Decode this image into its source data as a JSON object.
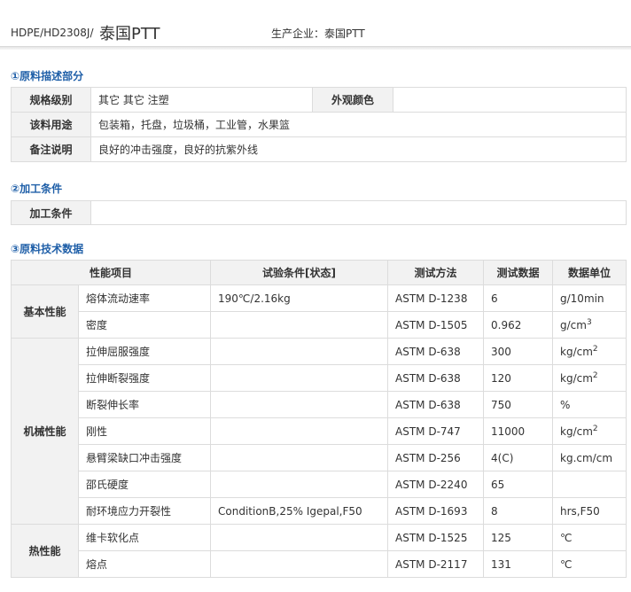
{
  "header": {
    "code": "HDPE/HD2308J/",
    "brand": "泰国PTT",
    "producer": "生产企业：泰国PTT"
  },
  "section1": {
    "title": "①原料描述部分",
    "rows": {
      "grade_label": "规格级别",
      "grade_value": "其它 其它 注塑",
      "appearance_label": "外观颜色",
      "appearance_value": "",
      "usage_label": "该料用途",
      "usage_value": "包装箱，托盘，垃圾桶，工业管，水果篮",
      "notes_label": "备注说明",
      "notes_value": "良好的冲击强度，良好的抗紫外线"
    }
  },
  "section2": {
    "title": "②加工条件",
    "label": "加工条件",
    "value": ""
  },
  "section3": {
    "title": "③原料技术数据",
    "headers": [
      "性能项目",
      "试验条件[状态]",
      "测试方法",
      "测试数据",
      "数据单位"
    ],
    "groups": {
      "basic": "基本性能",
      "mechanical": "机械性能",
      "thermal": "热性能"
    },
    "rows": [
      {
        "item": "熔体流动速率",
        "cond": "190℃/2.16kg",
        "method": "ASTM D-1238",
        "value": "6",
        "unit": "g/10min",
        "sup": ""
      },
      {
        "item": "密度",
        "cond": "",
        "method": "ASTM D-1505",
        "value": "0.962",
        "unit": "g/cm",
        "sup": "3"
      },
      {
        "item": "拉伸屈服强度",
        "cond": "",
        "method": "ASTM D-638",
        "value": "300",
        "unit": "kg/cm",
        "sup": "2"
      },
      {
        "item": "拉伸断裂强度",
        "cond": "",
        "method": "ASTM D-638",
        "value": "120",
        "unit": "kg/cm",
        "sup": "2"
      },
      {
        "item": "断裂伸长率",
        "cond": "",
        "method": "ASTM D-638",
        "value": "750",
        "unit": "%",
        "sup": ""
      },
      {
        "item": "刚性",
        "cond": "",
        "method": "ASTM D-747",
        "value": "11000",
        "unit": "kg/cm",
        "sup": "2"
      },
      {
        "item": "悬臂梁缺口冲击强度",
        "cond": "",
        "method": "ASTM D-256",
        "value": "4(C)",
        "unit": "kg.cm/cm",
        "sup": ""
      },
      {
        "item": "邵氏硬度",
        "cond": "",
        "method": "ASTM D-2240",
        "value": "65",
        "unit": "",
        "sup": ""
      },
      {
        "item": "耐环境应力开裂性",
        "cond": "ConditionB,25% Igepal,F50",
        "method": "ASTM D-1693",
        "value": "8",
        "unit": "hrs,F50",
        "sup": ""
      },
      {
        "item": "维卡软化点",
        "cond": "",
        "method": "ASTM D-1525",
        "value": "125",
        "unit": "℃",
        "sup": ""
      },
      {
        "item": "熔点",
        "cond": "",
        "method": "ASTM D-2117",
        "value": "131",
        "unit": "℃",
        "sup": ""
      }
    ]
  }
}
